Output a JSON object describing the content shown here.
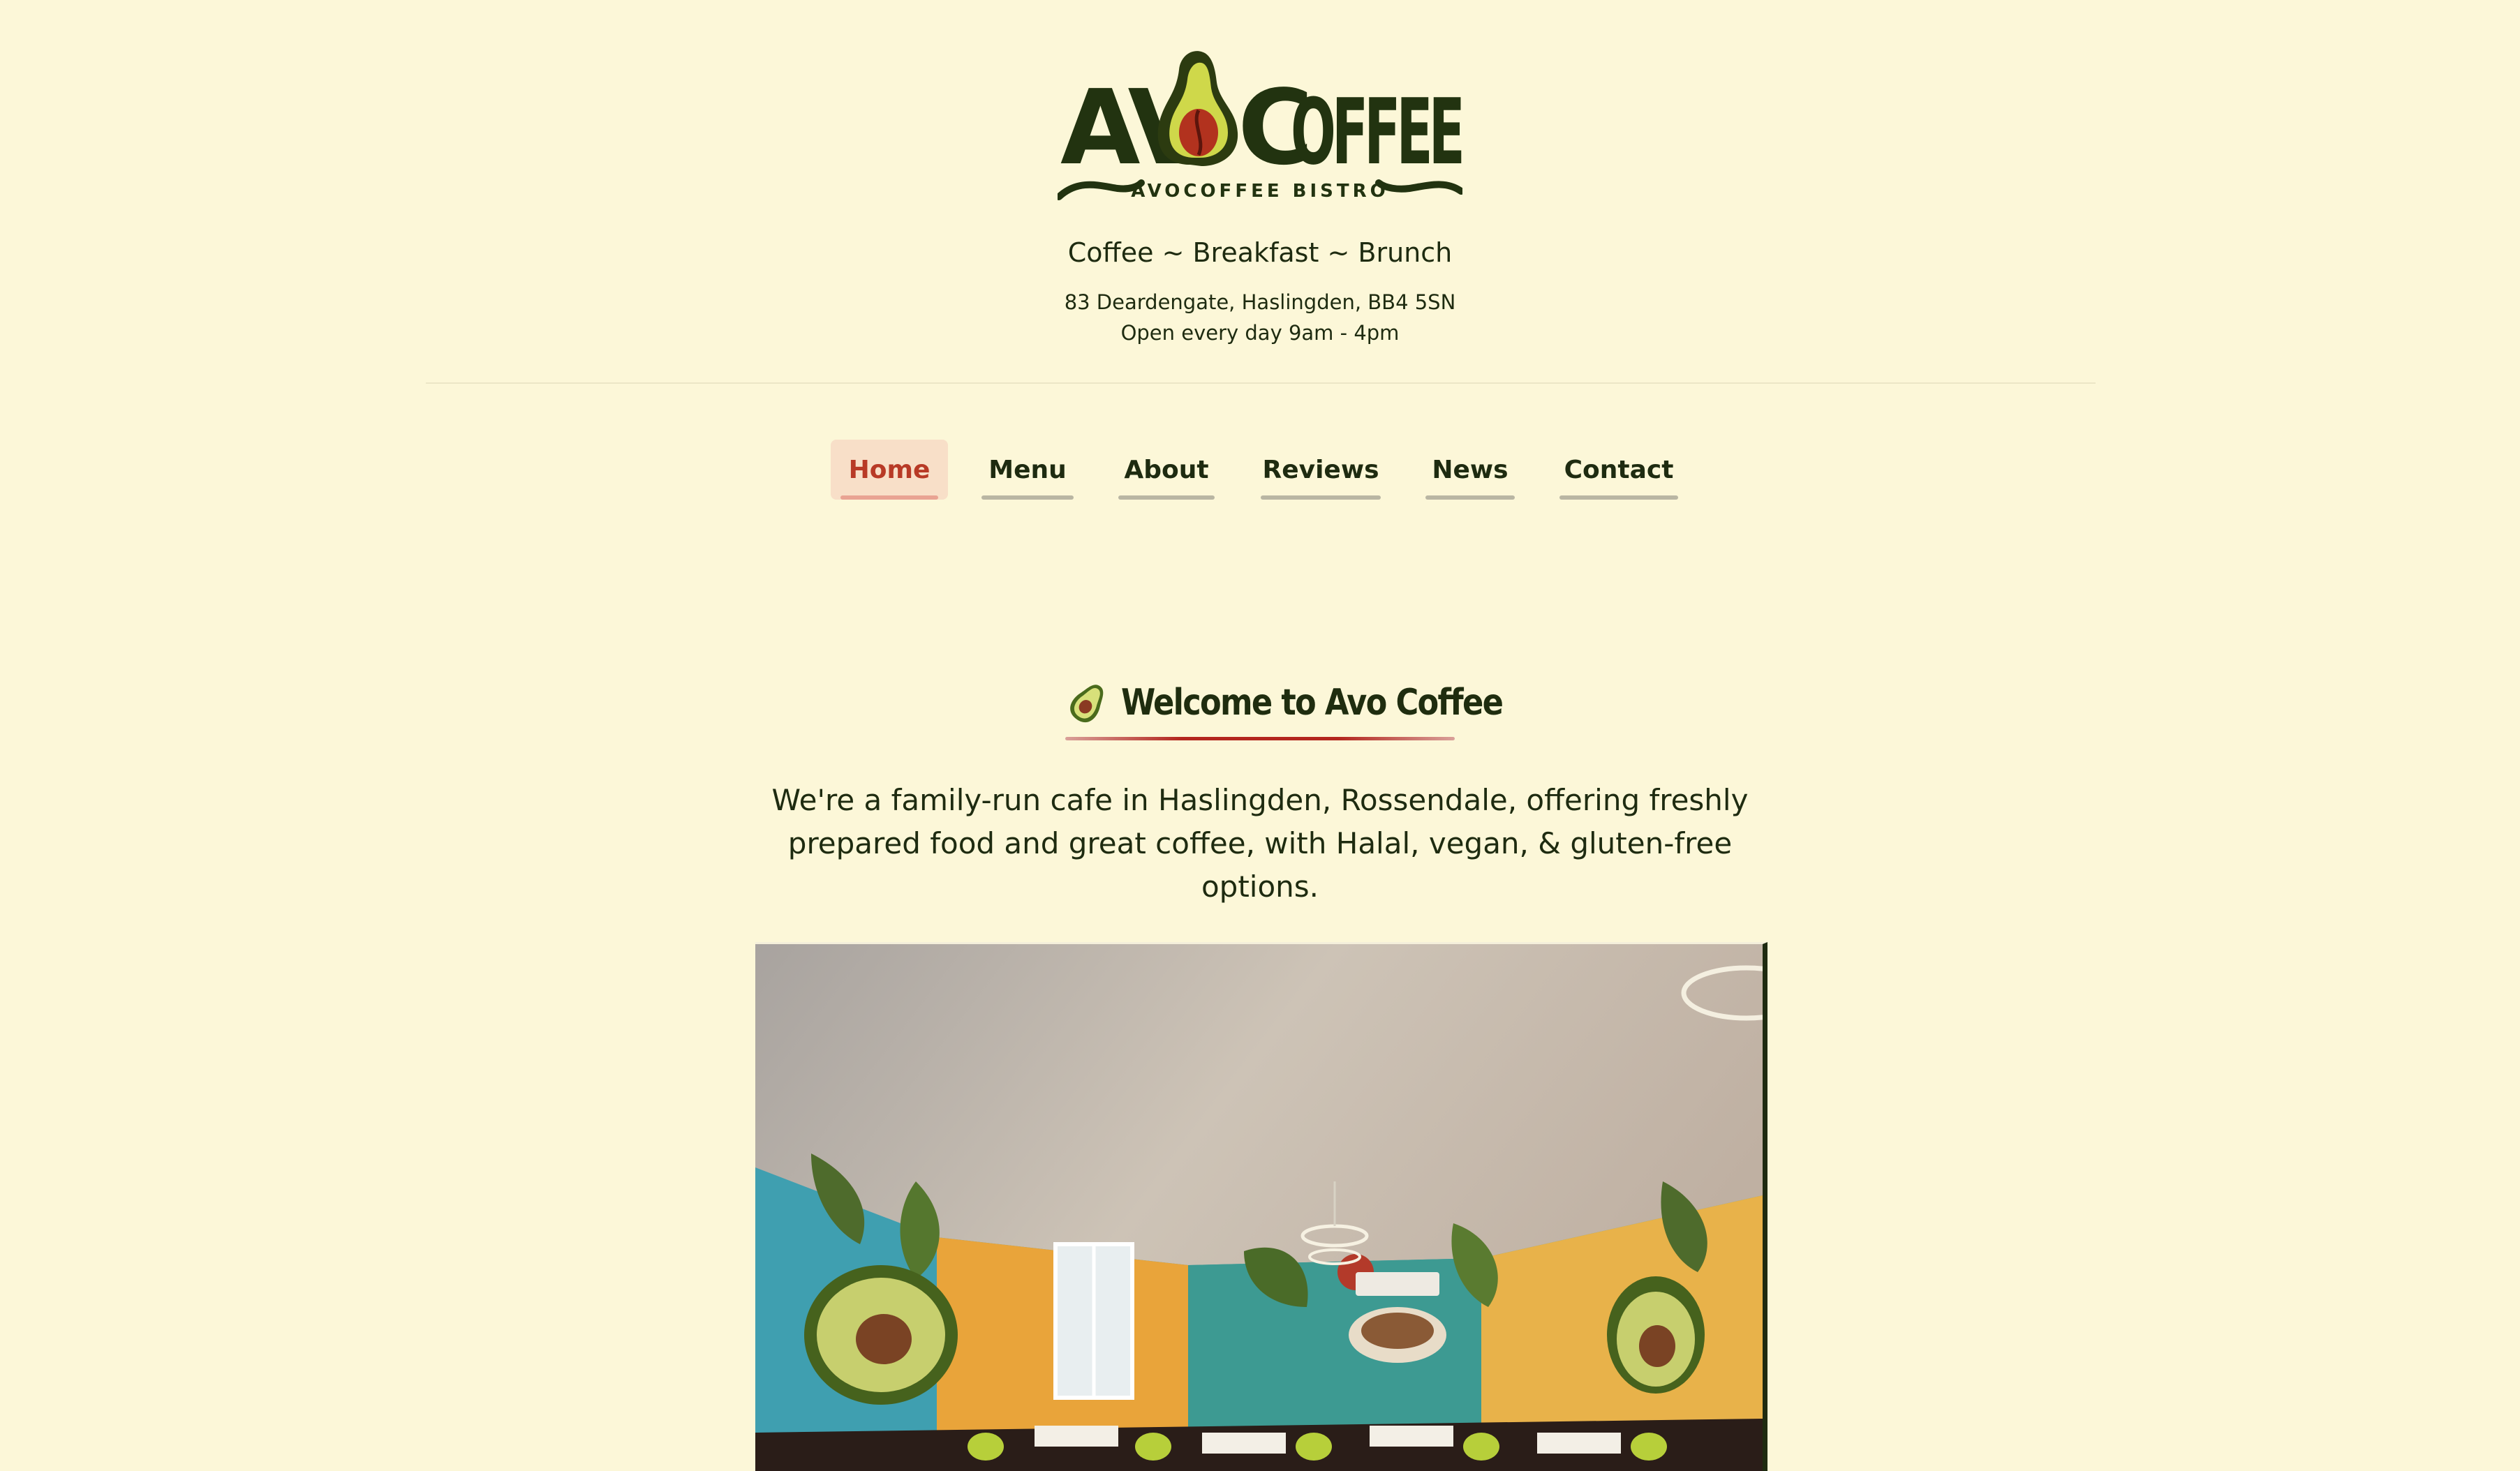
{
  "header": {
    "logo_text_left": "AV",
    "logo_text_right": "OFFEE",
    "logo_text_c": "C",
    "logo_subtext": "AVOCOFFEE BISTRO",
    "tagline": "Coffee ~ Breakfast ~ Brunch",
    "address": "83 Deardengate, Haslingden, BB4 5SN",
    "hours": "Open every day 9am - 4pm"
  },
  "nav": {
    "items": [
      {
        "label": "Home",
        "active": true
      },
      {
        "label": "Menu",
        "active": false
      },
      {
        "label": "About",
        "active": false
      },
      {
        "label": "Reviews",
        "active": false
      },
      {
        "label": "News",
        "active": false
      },
      {
        "label": "Contact",
        "active": false
      }
    ]
  },
  "main": {
    "welcome_icon": "avocado-icon",
    "welcome_title": "Welcome to Avo Coffee",
    "intro_line1": "We're a family-run cafe in Haslingden, Rossendale, offering freshly",
    "intro_line2": "prepared food and great coffee, with Halal, vegan, & gluten-free options."
  },
  "colors": {
    "background": "#fcf7d8",
    "brand_green": "#1e2b10",
    "accent_red": "#b3261d",
    "active_nav_bg": "#f8dfc8"
  }
}
